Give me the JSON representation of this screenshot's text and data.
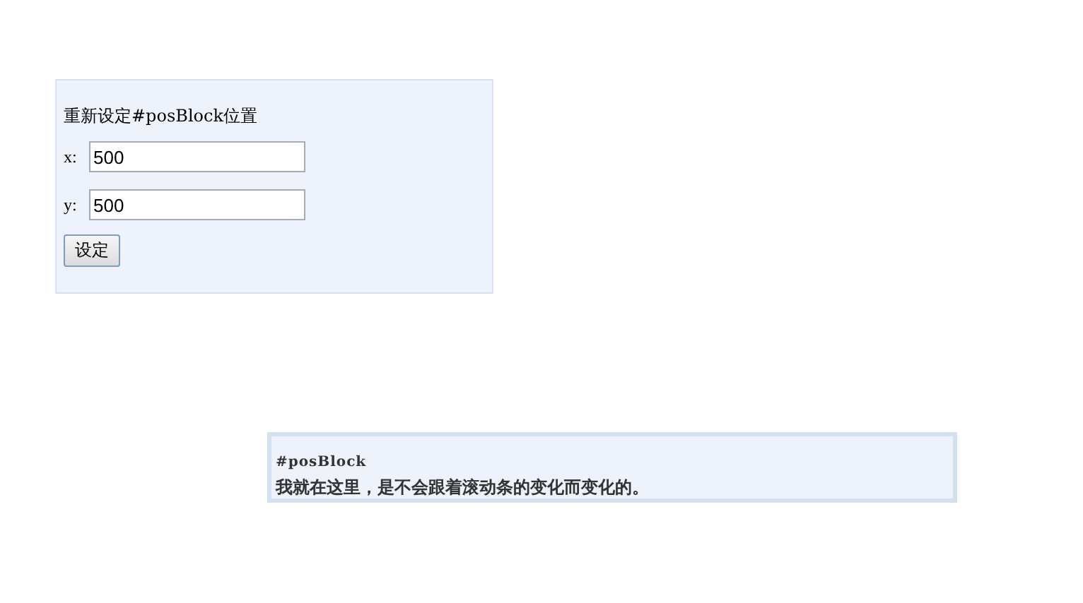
{
  "form_panel": {
    "title": "重新设定#posBlock位置",
    "fields": [
      {
        "label": "x:",
        "value": "500"
      },
      {
        "label": "y:",
        "value": "500"
      }
    ],
    "button": "设定"
  },
  "pos_block": {
    "heading": "#posBlock",
    "text": "我就在这里，是不会跟着滚动条的变化而变化的。"
  }
}
